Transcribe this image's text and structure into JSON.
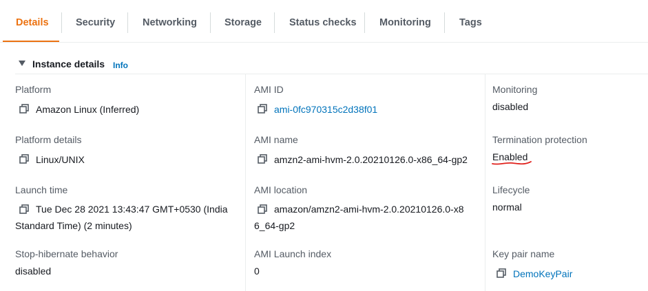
{
  "tabs": [
    {
      "label": "Details",
      "active": true
    },
    {
      "label": "Security"
    },
    {
      "label": "Networking"
    },
    {
      "label": "Storage"
    },
    {
      "label": "Status checks"
    },
    {
      "label": "Monitoring"
    },
    {
      "label": "Tags"
    }
  ],
  "section": {
    "title": "Instance details",
    "info": "Info"
  },
  "fields": {
    "platform": {
      "label": "Platform",
      "value": "Amazon Linux (Inferred)"
    },
    "platform_details": {
      "label": "Platform details",
      "value": "Linux/UNIX"
    },
    "launch_time": {
      "label": "Launch time",
      "value": "Tue Dec 28 2021 13:43:47 GMT+0530 (India Standard Time) (2 minutes)"
    },
    "stop_hibernate": {
      "label": "Stop-hibernate behavior",
      "value": "disabled"
    },
    "ami_id": {
      "label": "AMI ID",
      "value": "ami-0fc970315c2d38f01"
    },
    "ami_name": {
      "label": "AMI name",
      "value": "amzn2-ami-hvm-2.0.20210126.0-x86_64-gp2"
    },
    "ami_location": {
      "label": "AMI location",
      "value": "amazon/amzn2-ami-hvm-2.0.20210126.0-x86_64-gp2"
    },
    "ami_launch_index": {
      "label": "AMI Launch index",
      "value": "0"
    },
    "monitoring": {
      "label": "Monitoring",
      "value": "disabled"
    },
    "termination_protection": {
      "label": "Termination protection",
      "value": "Enabled"
    },
    "lifecycle": {
      "label": "Lifecycle",
      "value": "normal"
    },
    "key_pair": {
      "label": "Key pair name",
      "value": "DemoKeyPair"
    }
  },
  "colors": {
    "accent": "#ec7211",
    "link": "#0073bb",
    "annotation": "#e0201b"
  }
}
